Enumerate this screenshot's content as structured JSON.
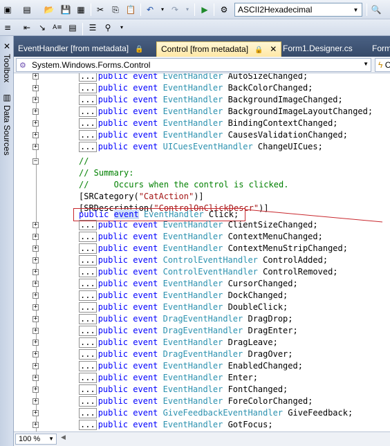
{
  "toolbar": {
    "config_combo_value": "ASCII2Hexadecimal"
  },
  "dock": {
    "toolbox_label": "Toolbox",
    "data_sources_label": "Data Sources"
  },
  "tabs": [
    {
      "label": "EventHandler [from metadata]"
    },
    {
      "label": "Control [from metadata]"
    },
    {
      "label": "Form1.Designer.cs"
    },
    {
      "label": "Form"
    }
  ],
  "navbar": {
    "type_combo": "System.Windows.Forms.Control",
    "member_combo": "C"
  },
  "code_lines_before": [
    {
      "type": "EventHandler",
      "name": "AutoSizeChanged;"
    },
    {
      "type": "EventHandler",
      "name": "BackColorChanged;"
    },
    {
      "type": "EventHandler",
      "name": "BackgroundImageChanged;"
    },
    {
      "type": "EventHandler",
      "name": "BackgroundImageLayoutChanged;"
    },
    {
      "type": "EventHandler",
      "name": "BindingContextChanged;"
    },
    {
      "type": "EventHandler",
      "name": "CausesValidationChanged;"
    },
    {
      "type": "UICuesEventHandler",
      "name": "ChangeUICues;"
    }
  ],
  "click_block": {
    "comment1": "//",
    "comment2": "// Summary:",
    "comment3": "//     Occurs when the control is clicked.",
    "attr1_prefix": "[SRCategory(",
    "attr1_string": "\"CatAction\"",
    "attr1_suffix": ")]",
    "attr2_prefix": "[SRDescription(",
    "attr2_string": "\"ControlOnClickDescr\"",
    "attr2_suffix": ")]",
    "decl_public": "public",
    "decl_event": "event",
    "decl_type": "EventHandler",
    "decl_name": "Click;"
  },
  "code_lines_after": [
    {
      "type": "EventHandler",
      "name": "ClientSizeChanged;"
    },
    {
      "type": "EventHandler",
      "name": "ContextMenuChanged;"
    },
    {
      "type": "EventHandler",
      "name": "ContextMenuStripChanged;"
    },
    {
      "type": "ControlEventHandler",
      "name": "ControlAdded;"
    },
    {
      "type": "ControlEventHandler",
      "name": "ControlRemoved;"
    },
    {
      "type": "EventHandler",
      "name": "CursorChanged;"
    },
    {
      "type": "EventHandler",
      "name": "DockChanged;"
    },
    {
      "type": "EventHandler",
      "name": "DoubleClick;"
    },
    {
      "type": "DragEventHandler",
      "name": "DragDrop;"
    },
    {
      "type": "DragEventHandler",
      "name": "DragEnter;"
    },
    {
      "type": "EventHandler",
      "name": "DragLeave;"
    },
    {
      "type": "DragEventHandler",
      "name": "DragOver;"
    },
    {
      "type": "EventHandler",
      "name": "EnabledChanged;"
    },
    {
      "type": "EventHandler",
      "name": "Enter;"
    },
    {
      "type": "EventHandler",
      "name": "FontChanged;"
    },
    {
      "type": "EventHandler",
      "name": "ForeColorChanged;"
    },
    {
      "type": "GiveFeedbackEventHandler",
      "name": "GiveFeedback;"
    },
    {
      "type": "EventHandler",
      "name": "GotFocus;"
    }
  ],
  "code_prefix": {
    "dots": "...",
    "public": "public",
    "event": "event"
  },
  "status": {
    "zoom": "100 %"
  },
  "colors": {
    "keyword": "#0000ff",
    "type": "#2b91af",
    "comment": "#008000",
    "string": "#a31515",
    "highlight_box": "#c8262c"
  }
}
